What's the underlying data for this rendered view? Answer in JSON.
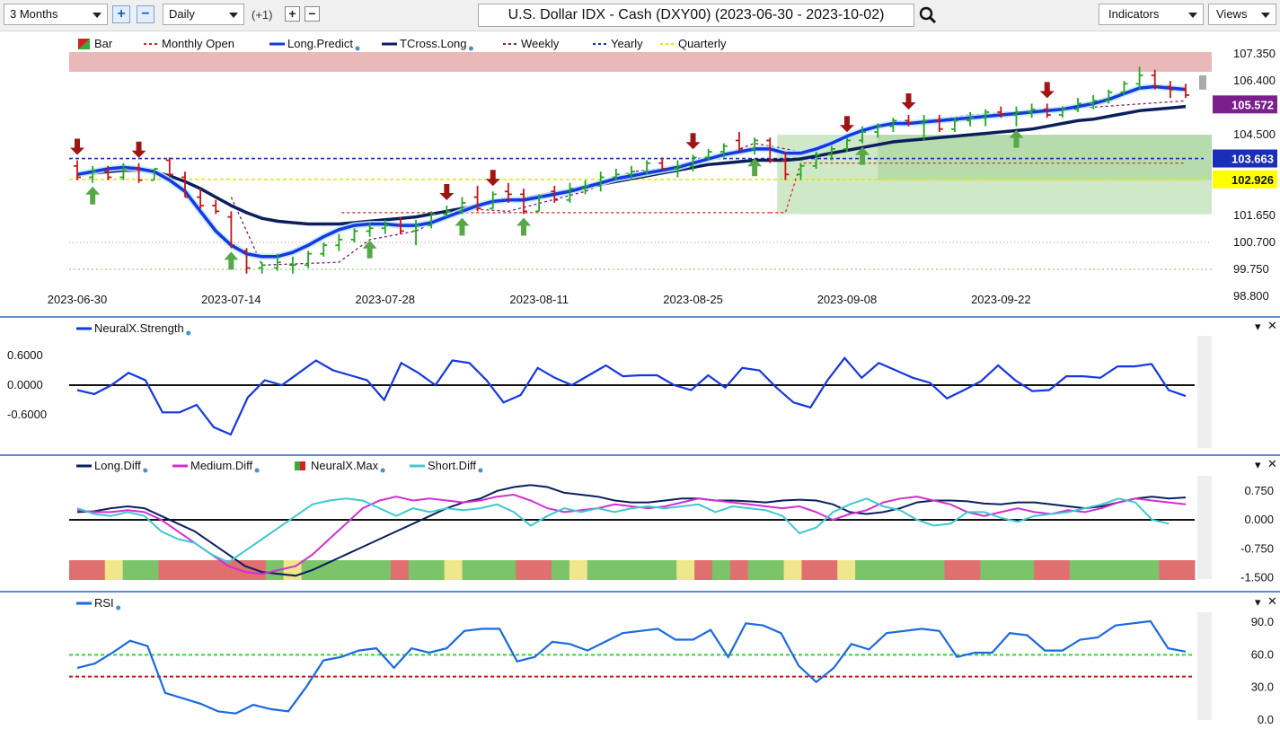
{
  "toolbar": {
    "range_label": "3 Months",
    "interval_label": "Daily",
    "offset_label": "(+1)",
    "title": "U.S. Dollar IDX - Cash (DXY00) (2023-06-30 - 2023-10-02)",
    "indicators_label": "Indicators",
    "views_label": "Views"
  },
  "chart_data": [
    {
      "type": "candlestick",
      "title": "U.S. Dollar IDX - Cash (DXY00) (2023-06-30 - 2023-10-02)",
      "legend": [
        "Bar",
        "Monthly Open",
        "Long.Predict",
        "TCross.Long",
        "Weekly",
        "Yearly",
        "Quarterly"
      ],
      "x_ticks": [
        "2023-06-30",
        "2023-07-14",
        "2023-07-28",
        "2023-08-11",
        "2023-08-25",
        "2023-09-08",
        "2023-09-22"
      ],
      "y_ticks": [
        "107.350",
        "106.400",
        "104.500",
        "101.650",
        "100.700",
        "99.750",
        "98.800"
      ],
      "ylim": [
        98.8,
        107.8
      ],
      "price_tags": [
        {
          "value": "105.572",
          "color": "#7a1f8c"
        },
        {
          "value": "103.663",
          "color": "#1a2fb8"
        },
        {
          "value": "102.926",
          "color": "#ffff00"
        }
      ],
      "bars": [
        [
          103.4,
          103.6,
          102.9,
          103.0
        ],
        [
          103.0,
          103.4,
          102.8,
          103.2
        ],
        [
          103.2,
          103.4,
          102.9,
          103.0
        ],
        [
          103.0,
          103.5,
          102.9,
          103.3
        ],
        [
          103.3,
          103.5,
          102.8,
          102.9
        ],
        [
          102.9,
          103.3,
          102.9,
          103.3
        ],
        [
          103.6,
          103.7,
          103.0,
          103.1
        ],
        [
          103.0,
          103.2,
          102.3,
          102.3
        ],
        [
          102.3,
          102.6,
          101.9,
          102.0
        ],
        [
          102.0,
          102.2,
          101.7,
          101.8
        ],
        [
          101.6,
          101.8,
          100.5,
          100.6
        ],
        [
          100.4,
          100.5,
          99.6,
          99.8
        ],
        [
          99.8,
          100.0,
          99.6,
          99.9
        ],
        [
          99.8,
          100.3,
          99.7,
          100.0
        ],
        [
          99.9,
          100.2,
          99.6,
          99.9
        ],
        [
          99.9,
          100.4,
          99.8,
          100.3
        ],
        [
          100.3,
          100.7,
          100.2,
          100.6
        ],
        [
          100.6,
          101.0,
          100.4,
          100.8
        ],
        [
          100.8,
          101.2,
          100.7,
          101.1
        ],
        [
          101.1,
          101.4,
          100.9,
          101.2
        ],
        [
          101.2,
          101.5,
          101.0,
          101.3
        ],
        [
          101.3,
          101.6,
          101.0,
          101.1
        ],
        [
          101.1,
          101.5,
          100.6,
          101.3
        ],
        [
          101.3,
          101.8,
          101.2,
          101.7
        ],
        [
          101.7,
          102.0,
          101.6,
          101.8
        ],
        [
          101.8,
          102.3,
          101.7,
          102.1
        ],
        [
          102.3,
          102.7,
          101.8,
          101.9
        ],
        [
          101.9,
          102.5,
          101.9,
          102.4
        ],
        [
          102.5,
          102.8,
          102.1,
          102.4
        ],
        [
          102.4,
          102.6,
          101.7,
          101.8
        ],
        [
          101.8,
          102.4,
          101.8,
          102.3
        ],
        [
          102.5,
          102.7,
          102.1,
          102.2
        ],
        [
          102.2,
          102.8,
          102.1,
          102.6
        ],
        [
          102.6,
          102.9,
          102.4,
          102.7
        ],
        [
          102.7,
          103.2,
          102.5,
          103.0
        ],
        [
          103.0,
          103.3,
          102.9,
          103.1
        ],
        [
          103.1,
          103.4,
          102.9,
          103.2
        ],
        [
          103.2,
          103.6,
          103.1,
          103.5
        ],
        [
          103.5,
          103.7,
          103.3,
          103.3
        ],
        [
          103.3,
          103.6,
          103.0,
          103.4
        ],
        [
          103.4,
          103.8,
          103.2,
          103.7
        ],
        [
          103.7,
          104.0,
          103.6,
          103.9
        ],
        [
          103.9,
          104.2,
          103.7,
          104.1
        ],
        [
          104.3,
          104.6,
          103.9,
          104.0
        ],
        [
          104.0,
          104.4,
          103.8,
          104.3
        ],
        [
          104.3,
          104.4,
          103.5,
          103.6
        ],
        [
          103.6,
          103.9,
          102.9,
          103.1
        ],
        [
          103.1,
          103.5,
          102.9,
          103.4
        ],
        [
          103.4,
          103.9,
          103.3,
          103.8
        ],
        [
          103.8,
          104.1,
          103.6,
          104.0
        ],
        [
          104.0,
          104.4,
          103.9,
          104.3
        ],
        [
          104.3,
          104.8,
          104.2,
          104.6
        ],
        [
          104.6,
          104.9,
          104.4,
          104.8
        ],
        [
          104.8,
          105.1,
          104.6,
          105.0
        ],
        [
          105.0,
          105.2,
          104.8,
          104.9
        ],
        [
          104.9,
          105.2,
          104.3,
          105.0
        ],
        [
          105.0,
          105.2,
          104.6,
          104.7
        ],
        [
          104.7,
          105.1,
          104.6,
          105.0
        ],
        [
          105.0,
          105.3,
          104.8,
          105.1
        ],
        [
          105.1,
          105.4,
          104.8,
          105.3
        ],
        [
          105.3,
          105.5,
          105.1,
          105.2
        ],
        [
          105.2,
          105.5,
          104.8,
          105.3
        ],
        [
          105.3,
          105.6,
          105.1,
          105.4
        ],
        [
          105.4,
          105.6,
          105.1,
          105.2
        ],
        [
          105.2,
          105.5,
          105.1,
          105.4
        ],
        [
          105.4,
          105.8,
          105.3,
          105.6
        ],
        [
          105.6,
          105.9,
          105.4,
          105.7
        ],
        [
          105.7,
          106.1,
          105.6,
          106.0
        ],
        [
          106.0,
          106.4,
          105.9,
          106.3
        ],
        [
          106.3,
          106.9,
          106.1,
          106.6
        ],
        [
          106.6,
          106.8,
          106.1,
          106.2
        ],
        [
          106.2,
          106.4,
          105.8,
          106.1
        ],
        [
          106.1,
          106.3,
          105.8,
          105.9
        ]
      ],
      "series": [
        {
          "name": "Long.Predict",
          "values": [
            103.1,
            103.2,
            103.3,
            103.35,
            103.3,
            103.2,
            102.9,
            102.5,
            101.8,
            101.1,
            100.6,
            100.3,
            100.2,
            100.2,
            100.35,
            100.6,
            100.9,
            101.15,
            101.3,
            101.35,
            101.35,
            101.3,
            101.3,
            101.4,
            101.6,
            101.8,
            102.0,
            102.15,
            102.2,
            102.2,
            102.3,
            102.4,
            102.5,
            102.65,
            102.8,
            102.95,
            103.05,
            103.15,
            103.25,
            103.35,
            103.5,
            103.65,
            103.8,
            103.9,
            104.0,
            104.0,
            103.85,
            103.85,
            104.0,
            104.2,
            104.45,
            104.65,
            104.8,
            104.9,
            104.9,
            104.95,
            105.0,
            105.05,
            105.1,
            105.15,
            105.2,
            105.25,
            105.3,
            105.35,
            105.4,
            105.5,
            105.6,
            105.75,
            105.95,
            106.15,
            106.2,
            106.15,
            106.1
          ]
        },
        {
          "name": "TCross.Long",
          "values": [
            103.1,
            103.15,
            103.2,
            103.25,
            103.25,
            103.2,
            103.05,
            102.85,
            102.6,
            102.3,
            102.0,
            101.75,
            101.55,
            101.45,
            101.4,
            101.35,
            101.35,
            101.35,
            101.4,
            101.45,
            101.5,
            101.55,
            101.6,
            101.7,
            101.8,
            101.9,
            102.0,
            102.1,
            102.2,
            102.25,
            102.35,
            102.45,
            102.55,
            102.65,
            102.75,
            102.85,
            102.95,
            103.05,
            103.15,
            103.25,
            103.35,
            103.45,
            103.5,
            103.55,
            103.6,
            103.6,
            103.6,
            103.65,
            103.75,
            103.85,
            103.95,
            104.05,
            104.15,
            104.25,
            104.3,
            104.35,
            104.4,
            104.45,
            104.5,
            104.55,
            104.6,
            104.65,
            104.7,
            104.8,
            104.9,
            105.0,
            105.05,
            105.15,
            105.25,
            105.35,
            105.4,
            105.45,
            105.5
          ]
        }
      ]
    },
    {
      "type": "line",
      "legend": [
        "NeuralX.Strength"
      ],
      "y_ticks": [
        "0.6000",
        "0.0000",
        "-0.6000"
      ],
      "ylim": [
        -1.0,
        1.0
      ],
      "series": [
        {
          "name": "NeuralX.Strength",
          "values": [
            -0.1,
            -0.18,
            0.0,
            0.25,
            0.1,
            -0.55,
            -0.55,
            -0.4,
            -0.85,
            -1.0,
            -0.25,
            0.1,
            0.0,
            0.25,
            0.5,
            0.3,
            0.2,
            0.1,
            -0.3,
            0.45,
            0.25,
            0.0,
            0.5,
            0.45,
            0.1,
            -0.35,
            -0.2,
            0.35,
            0.15,
            0.0,
            0.2,
            0.4,
            0.18,
            0.2,
            0.2,
            0.0,
            -0.1,
            0.2,
            -0.05,
            0.35,
            0.3,
            -0.05,
            -0.35,
            -0.45,
            0.1,
            0.55,
            0.15,
            0.45,
            0.3,
            0.15,
            0.05,
            -0.27,
            -0.1,
            0.08,
            0.4,
            0.1,
            -0.12,
            -0.1,
            0.18,
            0.18,
            0.15,
            0.38,
            0.38,
            0.43,
            -0.1,
            -0.22
          ]
        }
      ]
    },
    {
      "type": "line",
      "legend": [
        "Long.Diff",
        "Medium.Diff",
        "NeuralX.Max",
        "Short.Diff"
      ],
      "y_ticks": [
        "0.750",
        "0.000",
        "-0.750",
        "-1.500"
      ],
      "ylim": [
        -1.5,
        1.0
      ],
      "series": [
        {
          "name": "Long.Diff",
          "values": [
            0.2,
            0.22,
            0.3,
            0.35,
            0.3,
            0.1,
            -0.1,
            -0.3,
            -0.6,
            -0.9,
            -1.2,
            -1.35,
            -1.4,
            -1.45,
            -1.3,
            -1.1,
            -0.9,
            -0.7,
            -0.5,
            -0.3,
            -0.1,
            0.1,
            0.3,
            0.45,
            0.55,
            0.75,
            0.85,
            0.9,
            0.85,
            0.7,
            0.65,
            0.6,
            0.5,
            0.45,
            0.45,
            0.5,
            0.55,
            0.55,
            0.5,
            0.5,
            0.48,
            0.45,
            0.5,
            0.52,
            0.5,
            0.4,
            0.2,
            0.15,
            0.2,
            0.3,
            0.45,
            0.5,
            0.5,
            0.48,
            0.42,
            0.4,
            0.45,
            0.45,
            0.4,
            0.35,
            0.3,
            0.35,
            0.45,
            0.55,
            0.6,
            0.55,
            0.58
          ]
        },
        {
          "name": "Medium.Diff",
          "values": [
            0.25,
            0.2,
            0.2,
            0.25,
            0.2,
            0.0,
            -0.3,
            -0.6,
            -0.9,
            -1.2,
            -1.35,
            -1.4,
            -1.3,
            -1.2,
            -0.9,
            -0.5,
            -0.1,
            0.3,
            0.5,
            0.6,
            0.5,
            0.55,
            0.5,
            0.45,
            0.5,
            0.6,
            0.65,
            0.5,
            0.3,
            0.2,
            0.25,
            0.3,
            0.4,
            0.35,
            0.3,
            0.35,
            0.45,
            0.55,
            0.5,
            0.45,
            0.4,
            0.35,
            0.3,
            0.35,
            0.2,
            0.0,
            0.15,
            0.25,
            0.45,
            0.55,
            0.6,
            0.5,
            0.4,
            0.2,
            0.1,
            0.2,
            0.3,
            0.2,
            0.15,
            0.25,
            0.2,
            0.3,
            0.45,
            0.55,
            0.5,
            0.45,
            0.4
          ]
        },
        {
          "name": "Short.Diff",
          "values": [
            0.3,
            0.15,
            0.1,
            0.2,
            0.1,
            -0.3,
            -0.5,
            -0.6,
            -0.9,
            -1.1,
            -0.8,
            -0.5,
            -0.2,
            0.1,
            0.4,
            0.5,
            0.55,
            0.5,
            0.3,
            0.1,
            0.3,
            0.2,
            0.3,
            0.25,
            0.3,
            0.4,
            0.2,
            -0.15,
            0.1,
            0.3,
            0.2,
            0.3,
            0.2,
            0.3,
            0.35,
            0.3,
            0.35,
            0.4,
            0.2,
            0.35,
            0.3,
            0.25,
            0.1,
            -0.35,
            -0.2,
            0.2,
            0.4,
            0.55,
            0.35,
            0.25,
            0.0,
            -0.15,
            -0.1,
            0.2,
            0.2,
            0.05,
            -0.05,
            0.1,
            0.15,
            0.2,
            0.3,
            0.4,
            0.55,
            0.45,
            0.0,
            -0.1
          ]
        }
      ],
      "regime_strip": [
        "red",
        "red",
        "yellow",
        "green",
        "green",
        "red",
        "red",
        "red",
        "red",
        "red",
        "red",
        "green",
        "yellow",
        "green",
        "green",
        "green",
        "green",
        "green",
        "red",
        "green",
        "green",
        "yellow",
        "green",
        "green",
        "green",
        "red",
        "red",
        "green",
        "yellow",
        "green",
        "green",
        "green",
        "green",
        "green",
        "yellow",
        "red",
        "green",
        "red",
        "green",
        "green",
        "yellow",
        "red",
        "red",
        "yellow",
        "green",
        "green",
        "green",
        "green",
        "green",
        "red",
        "red",
        "green",
        "green",
        "green",
        "red",
        "red",
        "green",
        "green",
        "green",
        "green",
        "green",
        "red",
        "red"
      ]
    },
    {
      "type": "line",
      "legend": [
        "RSI"
      ],
      "y_ticks": [
        "90.0",
        "60.0",
        "30.0",
        "0.0"
      ],
      "ylim": [
        0,
        100
      ],
      "series": [
        {
          "name": "RSI",
          "values": [
            48,
            52,
            62,
            73,
            68,
            25,
            20,
            15,
            8,
            6,
            14,
            10,
            8,
            30,
            55,
            58,
            64,
            66,
            48,
            66,
            62,
            66,
            82,
            84,
            84,
            54,
            58,
            72,
            70,
            64,
            72,
            80,
            82,
            84,
            74,
            74,
            83,
            58,
            89,
            87,
            80,
            50,
            35,
            48,
            70,
            65,
            80,
            82,
            84,
            82,
            58,
            62,
            62,
            80,
            78,
            64,
            64,
            74,
            76,
            87,
            89,
            91,
            66,
            63
          ]
        }
      ]
    }
  ]
}
